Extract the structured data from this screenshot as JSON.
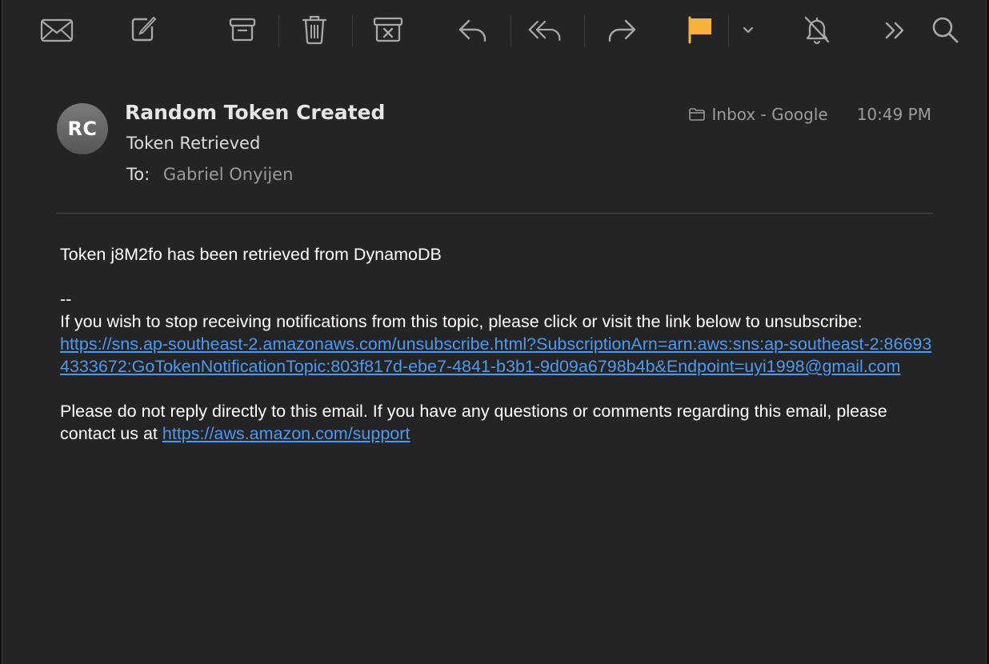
{
  "toolbar": {
    "buttons": [
      {
        "id": "get-mail",
        "icon": "envelope-icon"
      },
      {
        "id": "compose",
        "icon": "compose-icon"
      },
      {
        "id": "archive",
        "icon": "archive-box-icon"
      },
      {
        "id": "delete",
        "icon": "trash-icon"
      },
      {
        "id": "junk",
        "icon": "junk-box-icon"
      },
      {
        "id": "reply",
        "icon": "reply-icon"
      },
      {
        "id": "reply-all",
        "icon": "reply-all-icon"
      },
      {
        "id": "forward",
        "icon": "forward-icon"
      },
      {
        "id": "flag",
        "icon": "flag-icon",
        "color": "#f5b33b"
      },
      {
        "id": "flag-menu",
        "icon": "chevron-down-icon"
      },
      {
        "id": "mute",
        "icon": "bell-slash-icon"
      },
      {
        "id": "more",
        "icon": "double-chevron-right-icon"
      },
      {
        "id": "search",
        "icon": "magnifier-icon"
      }
    ]
  },
  "message": {
    "sender_initials": "RC",
    "sender_name": "Random Token Created",
    "subject": "Token Retrieved",
    "to_label": "To:",
    "recipient": "Gabriel Onyijen",
    "mailbox": "Inbox - Google",
    "mailbox_icon": "folder-icon",
    "time": "10:49 PM"
  },
  "body": {
    "line1": "Token j8M2fo has been retrieved from DynamoDB",
    "dashes": "--",
    "unsubscribe_text": "If you wish to stop receiving notifications from this topic, please click or visit the link below to unsubscribe:",
    "unsubscribe_link": "https://sns.ap-southeast-2.amazonaws.com/unsubscribe.html?SubscriptionArn=arn:aws:sns:ap-southeast-2:866934333672:GoTokenNotificationTopic:803f817d-ebe7-4841-b3b1-9d09a6798b4b&Endpoint=uyi1998@gmail.com",
    "reply_notice": "Please do not reply directly to this email. If you have any questions or comments regarding this email, please contact us at",
    "support_link": "https://aws.amazon.com/support"
  },
  "colors": {
    "background": "#242424",
    "link": "#4a9af0",
    "flag": "#f5b33b",
    "icon": "#a8a8a8"
  }
}
